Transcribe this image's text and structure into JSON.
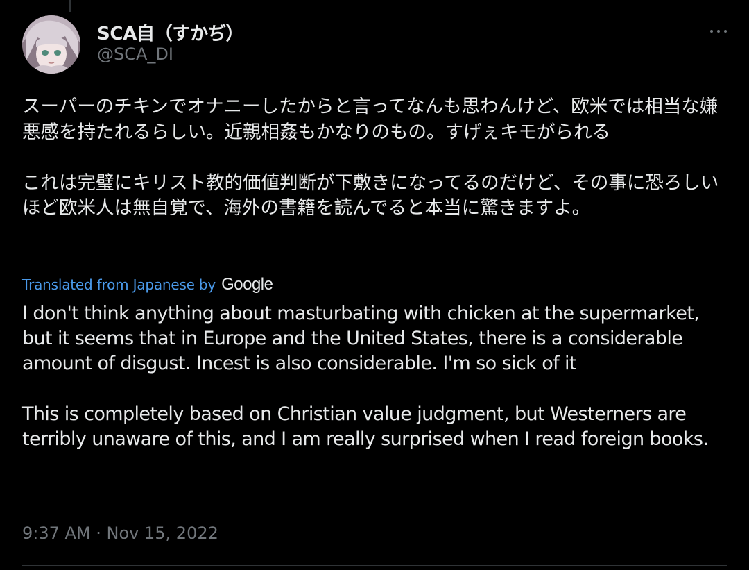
{
  "tweet": {
    "author": {
      "display_name": "SCA自（すかぢ）",
      "handle": "@SCA_DI",
      "avatar_icon": "avatar-anime-girl-icon"
    },
    "more_icon": "more-horizontal-icon",
    "original_text": {
      "paragraph_1": "スーパーのチキンでオナニーしたからと言ってなんも思わんけど、欧米では相当な嫌悪感を持たれるらしい。近親相姦もかなりのもの。すげぇキモがられる",
      "paragraph_2": "これは完璧にキリスト教的価値判断が下敷きになってるのだけど、その事に恐ろしいほど欧米人は無自覚で、海外の書籍を読んでると本当に驚きますよ。"
    },
    "translation": {
      "label": "Translated from Japanese by",
      "provider": "Google",
      "paragraph_1": "I don't think anything about masturbating with chicken at the supermarket, but it seems that in Europe and the United States, there is a considerable amount of disgust. Incest is also considerable. I'm so sick of it",
      "paragraph_2": "This is completely based on Christian value judgment, but Westerners are terribly unaware of this, and I am really surprised when I read foreign books."
    },
    "timestamp": "9:37 AM · Nov 15, 2022"
  },
  "colors": {
    "background": "#000000",
    "text_primary": "#e7e9ea",
    "text_secondary": "#71767b",
    "link": "#4a99e9",
    "divider": "#2f3336"
  }
}
